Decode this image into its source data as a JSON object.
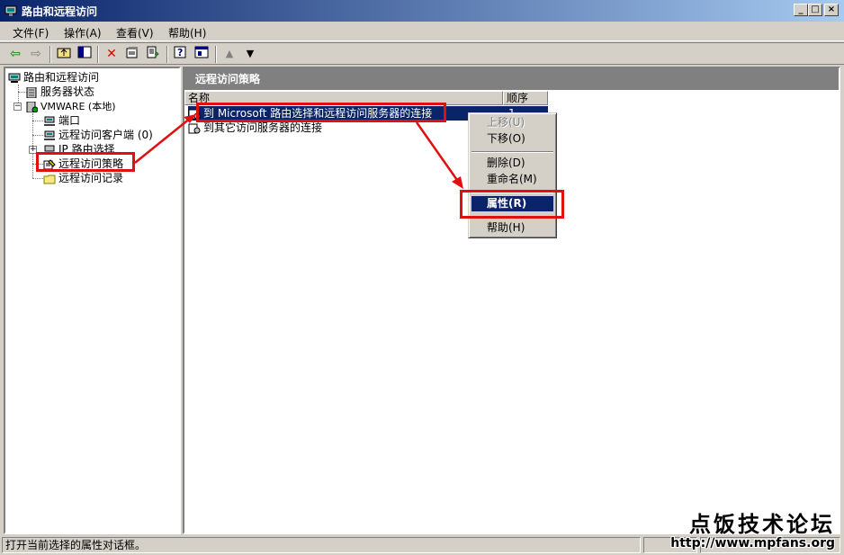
{
  "window": {
    "title": "路由和远程访问",
    "controls": {
      "minimize": "_",
      "maximize": "□",
      "close": "×"
    }
  },
  "menubar": [
    {
      "label": "文件(F)"
    },
    {
      "label": "操作(A)"
    },
    {
      "label": "查看(V)"
    },
    {
      "label": "帮助(H)"
    }
  ],
  "toolbar": {
    "back": "⇦",
    "forward": "⇨",
    "buttons": [
      "up-folder-icon",
      "show-hide-tree-icon",
      "delete-icon",
      "properties-icon",
      "export-icon",
      "help-icon",
      "console-icon",
      "move-up-icon",
      "move-down-icon"
    ]
  },
  "tree": {
    "root": "路由和远程访问",
    "server_status": "服务器状态",
    "server": "VMWARE (本地)",
    "ports": "端口",
    "remote_clients": "远程访问客户端 (0)",
    "ip_routing": "IP 路由选择",
    "remote_policies": "远程访问策略",
    "remote_logging": "远程访问记录"
  },
  "right_pane": {
    "header": "远程访问策略",
    "columns": [
      "名称",
      "顺序"
    ],
    "rows": [
      {
        "name": "到 Microsoft 路由选择和远程访问服务器的连接",
        "order": "1"
      },
      {
        "name": "到其它访问服务器的连接",
        "order": ""
      }
    ]
  },
  "context_menu": {
    "move_up": "上移(U)",
    "move_down": "下移(O)",
    "delete": "删除(D)",
    "rename": "重命名(M)",
    "properties": "属性(R)",
    "help": "帮助(H)"
  },
  "statusbar": {
    "text": "打开当前选择的属性对话框。"
  },
  "watermark": {
    "title": "点饭技术论坛",
    "url": "http://www.mpfans.org"
  },
  "colors": {
    "highlight": "#e01010",
    "selection": "#0a246a"
  }
}
